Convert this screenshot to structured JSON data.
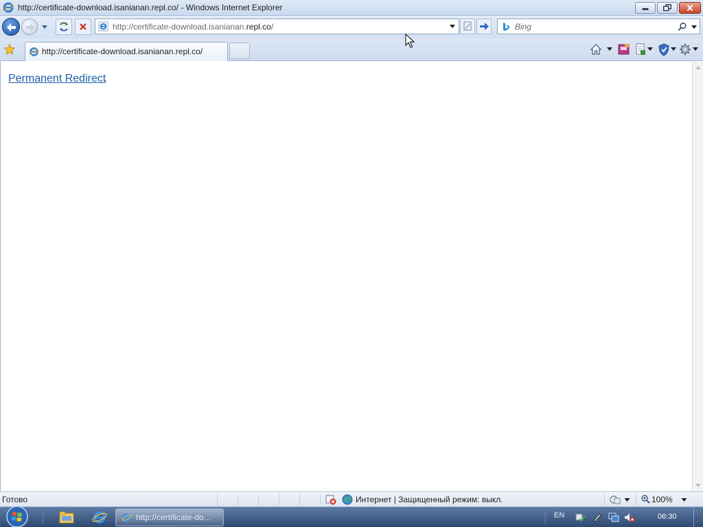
{
  "window": {
    "title": "http://certificate-download.isanianan.repl.co/ - Windows Internet Explorer"
  },
  "address_bar": {
    "url_prefix": "http://certificate-download.isanianan.",
    "url_domain": "repl.co",
    "url_suffix": "/"
  },
  "search": {
    "placeholder": "Bing"
  },
  "tab": {
    "title": "http://certificate-download.isanianan.repl.co/"
  },
  "page": {
    "link_text": "Permanent Redirect",
    "trailing": "."
  },
  "status": {
    "text": "Готово",
    "zone": "Интернет | Защищенный режим: выкл.",
    "zoom": "100%"
  },
  "taskbar": {
    "window_label": "http://certificate-do...",
    "language": "EN",
    "clock": "06:30"
  },
  "icons": {
    "browser": "ie-icon",
    "back": "back-arrow-icon",
    "forward": "forward-arrow-icon",
    "refresh": "refresh-icon",
    "stop": "stop-icon",
    "go": "go-arrow-icon",
    "search": "search-icon",
    "favorites": "favorites-star-icon",
    "home": "home-icon",
    "feeds": "feeds-icon",
    "print": "print-icon",
    "safety": "safety-icon",
    "tools": "tools-gear-icon"
  },
  "colors": {
    "link": "#1a5ea8",
    "chrome": "#d3e0f1",
    "taskbar": "#2f4a72"
  }
}
